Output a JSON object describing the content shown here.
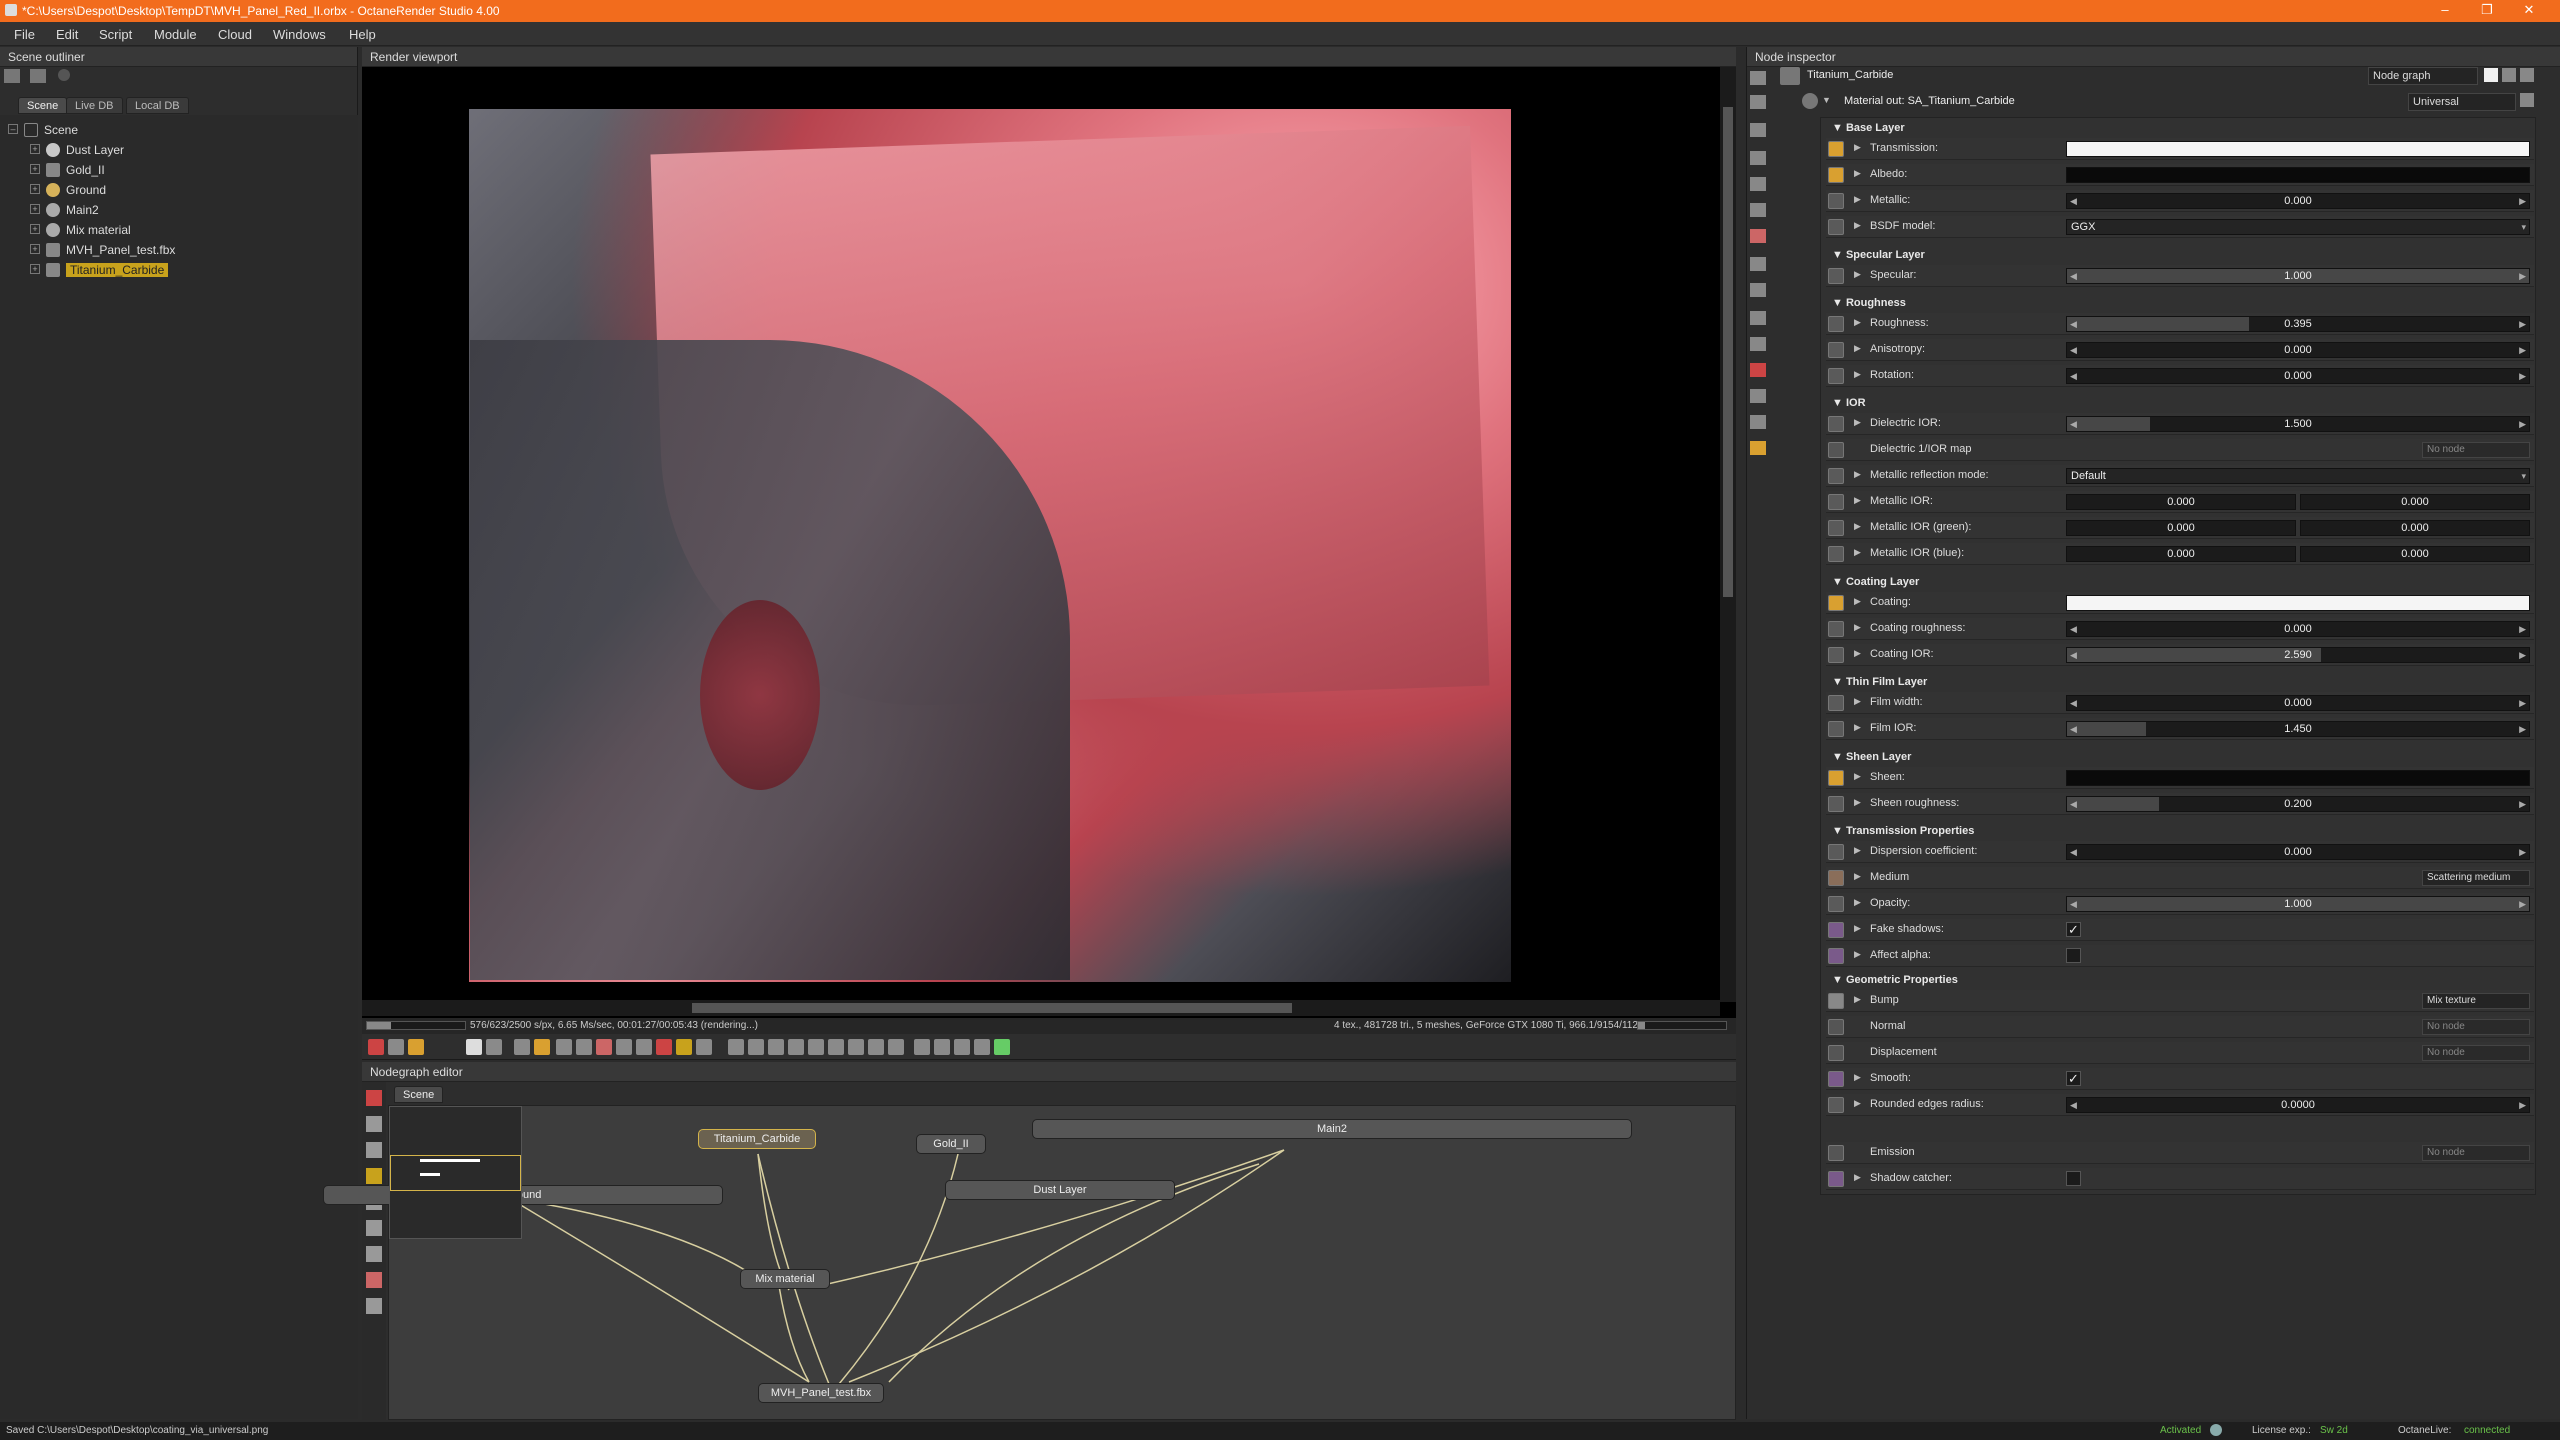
{
  "window": {
    "title": "*C:\\Users\\Despot\\Desktop\\TempDT\\MVH_Panel_Red_II.orbx - OctaneRender Studio 4.00",
    "minimize": "–",
    "maximize": "❐",
    "close": "✕"
  },
  "menu": [
    "File",
    "Edit",
    "Script",
    "Module",
    "Cloud",
    "Windows",
    "Help"
  ],
  "outliner": {
    "title": "Scene outliner",
    "tabs": [
      "Scene",
      "Live DB",
      "Local DB"
    ],
    "root": "Scene",
    "items": [
      {
        "label": "Dust Layer",
        "color": "#c8c8c8"
      },
      {
        "label": "Gold_II",
        "color": "#888"
      },
      {
        "label": "Ground",
        "color": "#d6b25a"
      },
      {
        "label": "Main2",
        "color": "#aaa"
      },
      {
        "label": "Mix material",
        "color": "#aaa"
      },
      {
        "label": "MVH_Panel_test.fbx",
        "color": "#888"
      },
      {
        "label": "Titanium_Carbide",
        "color": "#888"
      }
    ]
  },
  "viewport": {
    "title": "Render viewport",
    "stats_left": "576/623/2500 s/px, 6.65 Ms/sec, 00:01:27/00:05:43 (rendering...)",
    "stats_right": "4 tex., 481728 tri., 5 meshes, GeForce GTX 1080 Ti, 966.1/9154/11264 MB"
  },
  "nodegraph": {
    "title": "Nodegraph editor",
    "tab": "Scene",
    "nodes": {
      "titanium": "Titanium_Carbide",
      "gold": "Gold_II",
      "main2": "Main2",
      "ground": "Ground",
      "dust": "Dust Layer",
      "mix": "Mix material",
      "mvh": "MVH_Panel_test.fbx"
    }
  },
  "inspector": {
    "title": "Node inspector",
    "node_name": "Titanium_Carbide",
    "view_mode": "Node graph",
    "material_out": "Material out: SA_Titanium_Carbide",
    "material_type": "Universal",
    "sections": {
      "base": "Base Layer",
      "spec": "Specular Layer",
      "rough": "Roughness",
      "ior": "IOR",
      "coat": "Coating Layer",
      "thin": "Thin Film Layer",
      "sheen": "Sheen Layer",
      "trans": "Transmission Properties",
      "geo": "Geometric Properties"
    },
    "rows": {
      "transmission": {
        "label": "Transmission:"
      },
      "albedo": {
        "label": "Albedo:"
      },
      "metallic": {
        "label": "Metallic:",
        "value": "0.000",
        "fill": 0
      },
      "bsdf": {
        "label": "BSDF model:",
        "value": "GGX"
      },
      "specular": {
        "label": "Specular:",
        "value": "1.000",
        "fill": 1
      },
      "roughness": {
        "label": "Roughness:",
        "value": "0.395",
        "fill": 0.395
      },
      "anisotropy": {
        "label": "Anisotropy:",
        "value": "0.000",
        "fill": 0
      },
      "rotation": {
        "label": "Rotation:",
        "value": "0.000",
        "fill": 0
      },
      "dielectric_ior": {
        "label": "Dielectric IOR:",
        "value": "1.500",
        "fill": 0.18
      },
      "dielectric_map": {
        "label": "Dielectric 1/IOR map",
        "value": "No node"
      },
      "metallic_mode": {
        "label": "Metallic reflection mode:",
        "value": "Default"
      },
      "metallic_ior": {
        "label": "Metallic IOR:",
        "v1": "0.000",
        "v2": "0.000"
      },
      "metallic_ior_g": {
        "label": "Metallic IOR (green):",
        "v1": "0.000",
        "v2": "0.000"
      },
      "metallic_ior_b": {
        "label": "Metallic IOR (blue):",
        "v1": "0.000",
        "v2": "0.000"
      },
      "coating": {
        "label": "Coating:"
      },
      "coating_rough": {
        "label": "Coating roughness:",
        "value": "0.000",
        "fill": 0
      },
      "coating_ior": {
        "label": "Coating IOR:",
        "value": "2.590",
        "fill": 0.55
      },
      "film_width": {
        "label": "Film width:",
        "value": "0.000",
        "fill": 0
      },
      "film_ior": {
        "label": "Film IOR:",
        "value": "1.450",
        "fill": 0.17
      },
      "sheen": {
        "label": "Sheen:"
      },
      "sheen_rough": {
        "label": "Sheen roughness:",
        "value": "0.200",
        "fill": 0.2
      },
      "dispersion": {
        "label": "Dispersion coefficient:",
        "value": "0.000",
        "fill": 0
      },
      "medium": {
        "label": "Medium",
        "value": "Scattering medium"
      },
      "opacity": {
        "label": "Opacity:",
        "value": "1.000",
        "fill": 1
      },
      "fake_shadows": {
        "label": "Fake shadows:",
        "checked": "✓"
      },
      "affect_alpha": {
        "label": "Affect alpha:",
        "checked": ""
      },
      "bump": {
        "label": "Bump",
        "value": "Mix texture"
      },
      "normal": {
        "label": "Normal",
        "value": "No node"
      },
      "displacement": {
        "label": "Displacement",
        "value": "No node"
      },
      "smooth": {
        "label": "Smooth:",
        "checked": "✓"
      },
      "rounded": {
        "label": "Rounded edges radius:",
        "value": "0.0000",
        "fill": 0
      },
      "emission": {
        "label": "Emission",
        "value": "No node"
      },
      "shadow_catcher": {
        "label": "Shadow catcher:",
        "checked": ""
      }
    }
  },
  "status": {
    "saved": "Saved C:\\Users\\Despot\\Desktop\\coating_via_universal.png",
    "activated": "Activated",
    "license_label": "License exp.:",
    "license_value": "Sw 2d",
    "live_label": "OctaneLive:",
    "live_value": "connected",
    "accent": "#f26c1d",
    "ok_color": "#6ac24a"
  }
}
